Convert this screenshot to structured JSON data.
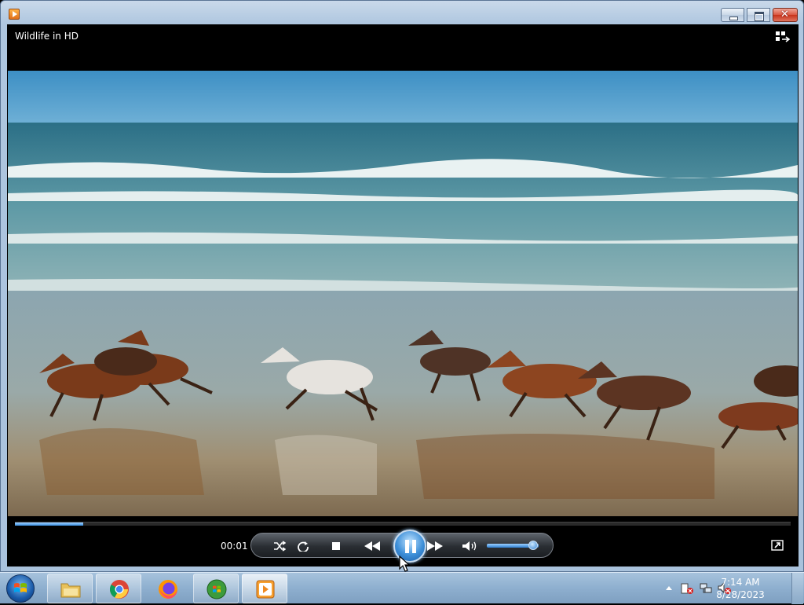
{
  "window": {
    "title": "Wildlife in HD"
  },
  "playback": {
    "elapsed": "00:01",
    "progress_fraction": 0.088,
    "volume_fraction": 0.9
  },
  "taskbar": {
    "apps": [
      {
        "name": "windows-explorer",
        "icon": "folder-icon"
      },
      {
        "name": "google-chrome",
        "icon": "chrome-icon"
      },
      {
        "name": "firefox",
        "icon": "firefox-icon"
      },
      {
        "name": "windows-media-center",
        "icon": "media-center-icon"
      },
      {
        "name": "windows-media-player",
        "icon": "media-player-icon"
      }
    ],
    "clock": {
      "time": "7:14 AM",
      "date": "8/28/2023"
    }
  },
  "colors": {
    "accent": "#3b8fe0",
    "close": "#c7321a"
  }
}
